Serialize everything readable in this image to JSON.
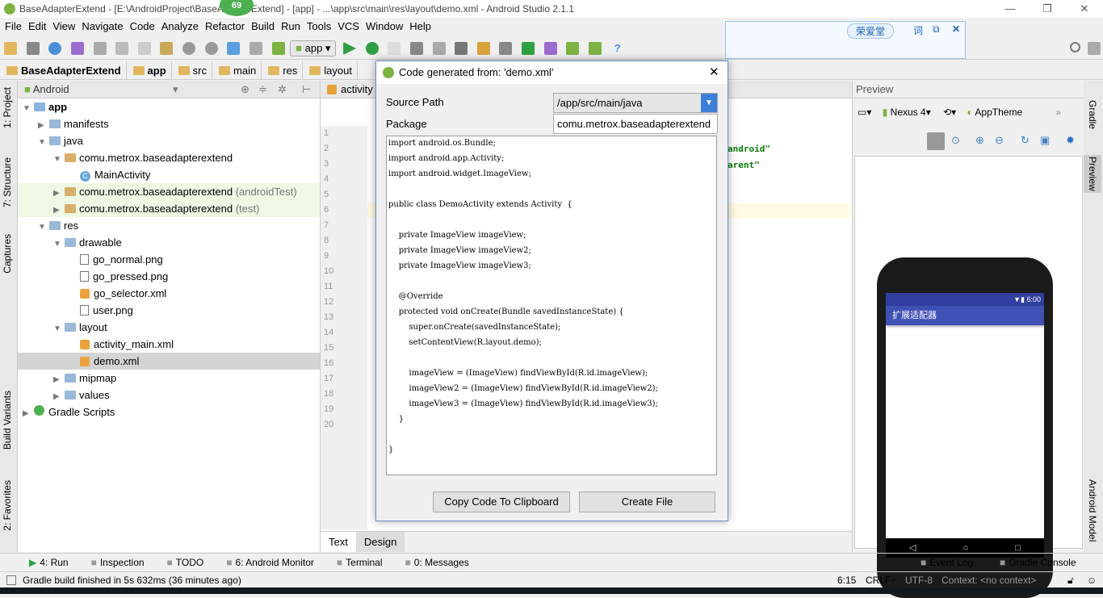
{
  "window": {
    "title": "BaseAdapterExtend - [E:\\AndroidProject\\BaseAdapterExtend] - [app] - ...\\app\\src\\main\\res\\layout\\demo.xml - Android Studio 2.1.1",
    "badge": "69"
  },
  "menu": [
    "File",
    "Edit",
    "View",
    "Navigate",
    "Code",
    "Analyze",
    "Refactor",
    "Build",
    "Run",
    "Tools",
    "VCS",
    "Window",
    "Help"
  ],
  "toolbar": {
    "run_config": "app"
  },
  "breadcrumb": [
    "BaseAdapterExtend",
    "app",
    "src",
    "main",
    "res",
    "layout"
  ],
  "ime": {
    "name": "荣爱堂",
    "btn1": "词",
    "btn2": "⧉",
    "close": "✕"
  },
  "left_tabs": [
    "1: Project",
    "7: Structure",
    "Captures",
    "Build Variants",
    "2: Favorites"
  ],
  "project": {
    "view": "Android",
    "tree": [
      {
        "label": "app",
        "level": 0,
        "icon": "module",
        "open": true,
        "bold": true
      },
      {
        "label": "manifests",
        "level": 1,
        "icon": "folder",
        "open": false
      },
      {
        "label": "java",
        "level": 1,
        "icon": "folder",
        "open": true
      },
      {
        "label": "comu.metrox.baseadapterextend",
        "level": 2,
        "icon": "package",
        "open": true
      },
      {
        "label": "MainActivity",
        "level": 3,
        "icon": "class"
      },
      {
        "label": "comu.metrox.baseadapterextend",
        "suffix": "(androidTest)",
        "level": 2,
        "icon": "package",
        "open": false,
        "hl": true
      },
      {
        "label": "comu.metrox.baseadapterextend",
        "suffix": "(test)",
        "level": 2,
        "icon": "package",
        "open": false,
        "hl": true
      },
      {
        "label": "res",
        "level": 1,
        "icon": "folder",
        "open": true
      },
      {
        "label": "drawable",
        "level": 2,
        "icon": "folder",
        "open": true
      },
      {
        "label": "go_normal.png",
        "level": 3,
        "icon": "file"
      },
      {
        "label": "go_pressed.png",
        "level": 3,
        "icon": "file"
      },
      {
        "label": "go_selector.xml",
        "level": 3,
        "icon": "xml"
      },
      {
        "label": "user.png",
        "level": 3,
        "icon": "file"
      },
      {
        "label": "layout",
        "level": 2,
        "icon": "folder",
        "open": true
      },
      {
        "label": "activity_main.xml",
        "level": 3,
        "icon": "xml"
      },
      {
        "label": "demo.xml",
        "level": 3,
        "icon": "xml",
        "selected": true
      },
      {
        "label": "mipmap",
        "level": 2,
        "icon": "folder",
        "open": false
      },
      {
        "label": "values",
        "level": 2,
        "icon": "folder",
        "open": false
      },
      {
        "label": "Gradle Scripts",
        "level": 0,
        "icon": "gradle",
        "open": false
      }
    ]
  },
  "editor": {
    "tab": "activity",
    "line_numbers": [
      "1",
      "2",
      "3",
      "4",
      "5",
      "6",
      "7",
      "8",
      "9",
      "10",
      "11",
      "12",
      "13",
      "14",
      "15",
      "16",
      "17",
      "18",
      "19",
      "20"
    ],
    "code_frag1": "android\"",
    "code_frag2": "arent\"",
    "bottom_tabs": [
      "Text",
      "Design"
    ]
  },
  "dialog": {
    "title": "Code generated from: 'demo.xml'",
    "source_path_label": "Source Path",
    "source_path": "/app/src/main/java",
    "package_label": "Package",
    "package": "comu.metrox.baseadapterextend",
    "code": [
      "import android.os.Bundle;",
      "import android.app.Activity;",
      "import android.widget.ImageView;",
      "",
      "public class DemoActivity extends Activity  {",
      "",
      "    private ImageView imageView;",
      "    private ImageView imageView2;",
      "    private ImageView imageView3;",
      "",
      "    @Override",
      "    protected void onCreate(Bundle savedInstanceState) {",
      "        super.onCreate(savedInstanceState);",
      "        setContentView(R.layout.demo);",
      "",
      "        imageView = (ImageView) findViewById(R.id.imageView);",
      "        imageView2 = (ImageView) findViewById(R.id.imageView2);",
      "        imageView3 = (ImageView) findViewById(R.id.imageView3);",
      "    }",
      "",
      "}"
    ],
    "copy_button": "Copy Code To Clipboard",
    "create_button": "Create File"
  },
  "preview": {
    "title": "Preview",
    "device": "Nexus 4",
    "theme": "AppTheme",
    "status_time": "6:00",
    "app_title": "扩展适配器"
  },
  "right_tabs": [
    "Gradle",
    "Preview",
    "Android Model"
  ],
  "bottom_tools": [
    "4: Run",
    "Inspection",
    "TODO",
    "6: Android Monitor",
    "Terminal",
    "0: Messages"
  ],
  "bottom_tools_right": [
    "Event Log",
    "Gradle Console"
  ],
  "status": {
    "message": "Gradle build finished in 5s 632ms (36 minutes ago)",
    "position": "6:15",
    "line_sep": "CRLF÷",
    "encoding": "UTF-8",
    "context": "Context: <no context>"
  },
  "colors": {
    "accent": "#3f51b5",
    "run": "#2ea043",
    "dialog_border": "#6b8fc5"
  }
}
